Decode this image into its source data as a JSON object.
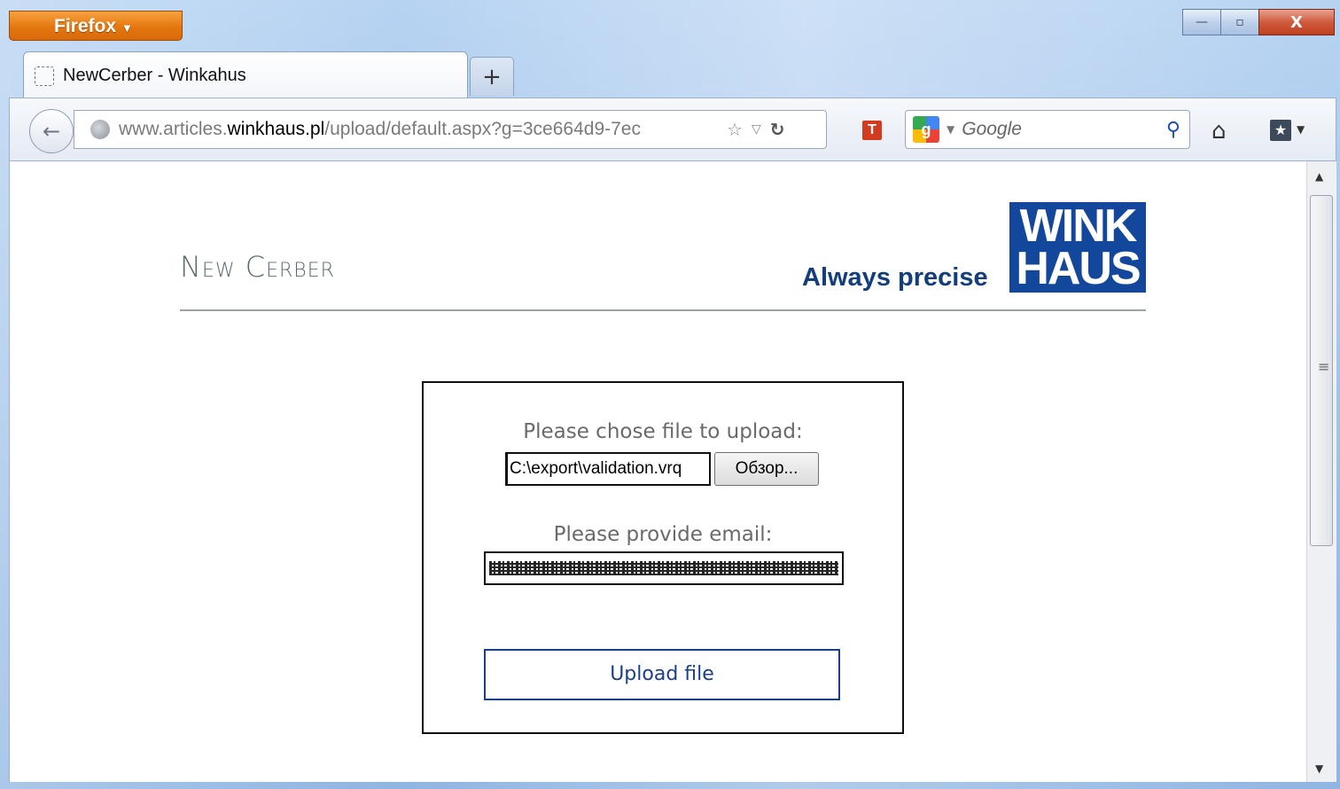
{
  "browser": {
    "menu_button": "Firefox",
    "tab_title": "NewCerber - Winkahus",
    "new_tab": "+",
    "url_prefix": "www.articles.",
    "url_domain": "winkhaus.pl",
    "url_suffix": "/upload/default.aspx?g=3ce664d9-7ec",
    "search_engine_letter": "g",
    "search_placeholder": "Google",
    "t_extension_letter": "T"
  },
  "window_controls": {
    "minimize": "—",
    "maximize": "▫",
    "close": "X"
  },
  "page": {
    "site_title": "New Cerber",
    "tagline": "Always precise",
    "logo_line1": "WINK",
    "logo_line2": "HAUS"
  },
  "form": {
    "file_label": "Please chose file to upload:",
    "file_value": "C:\\export\\validation.vrq",
    "browse_label": "Обзор...",
    "email_label": "Please provide email:",
    "upload_label": "Upload file"
  },
  "colors": {
    "brand_blue": "#12479b",
    "tagline_blue": "#123e7c",
    "firefox_orange": "#e4770f"
  }
}
